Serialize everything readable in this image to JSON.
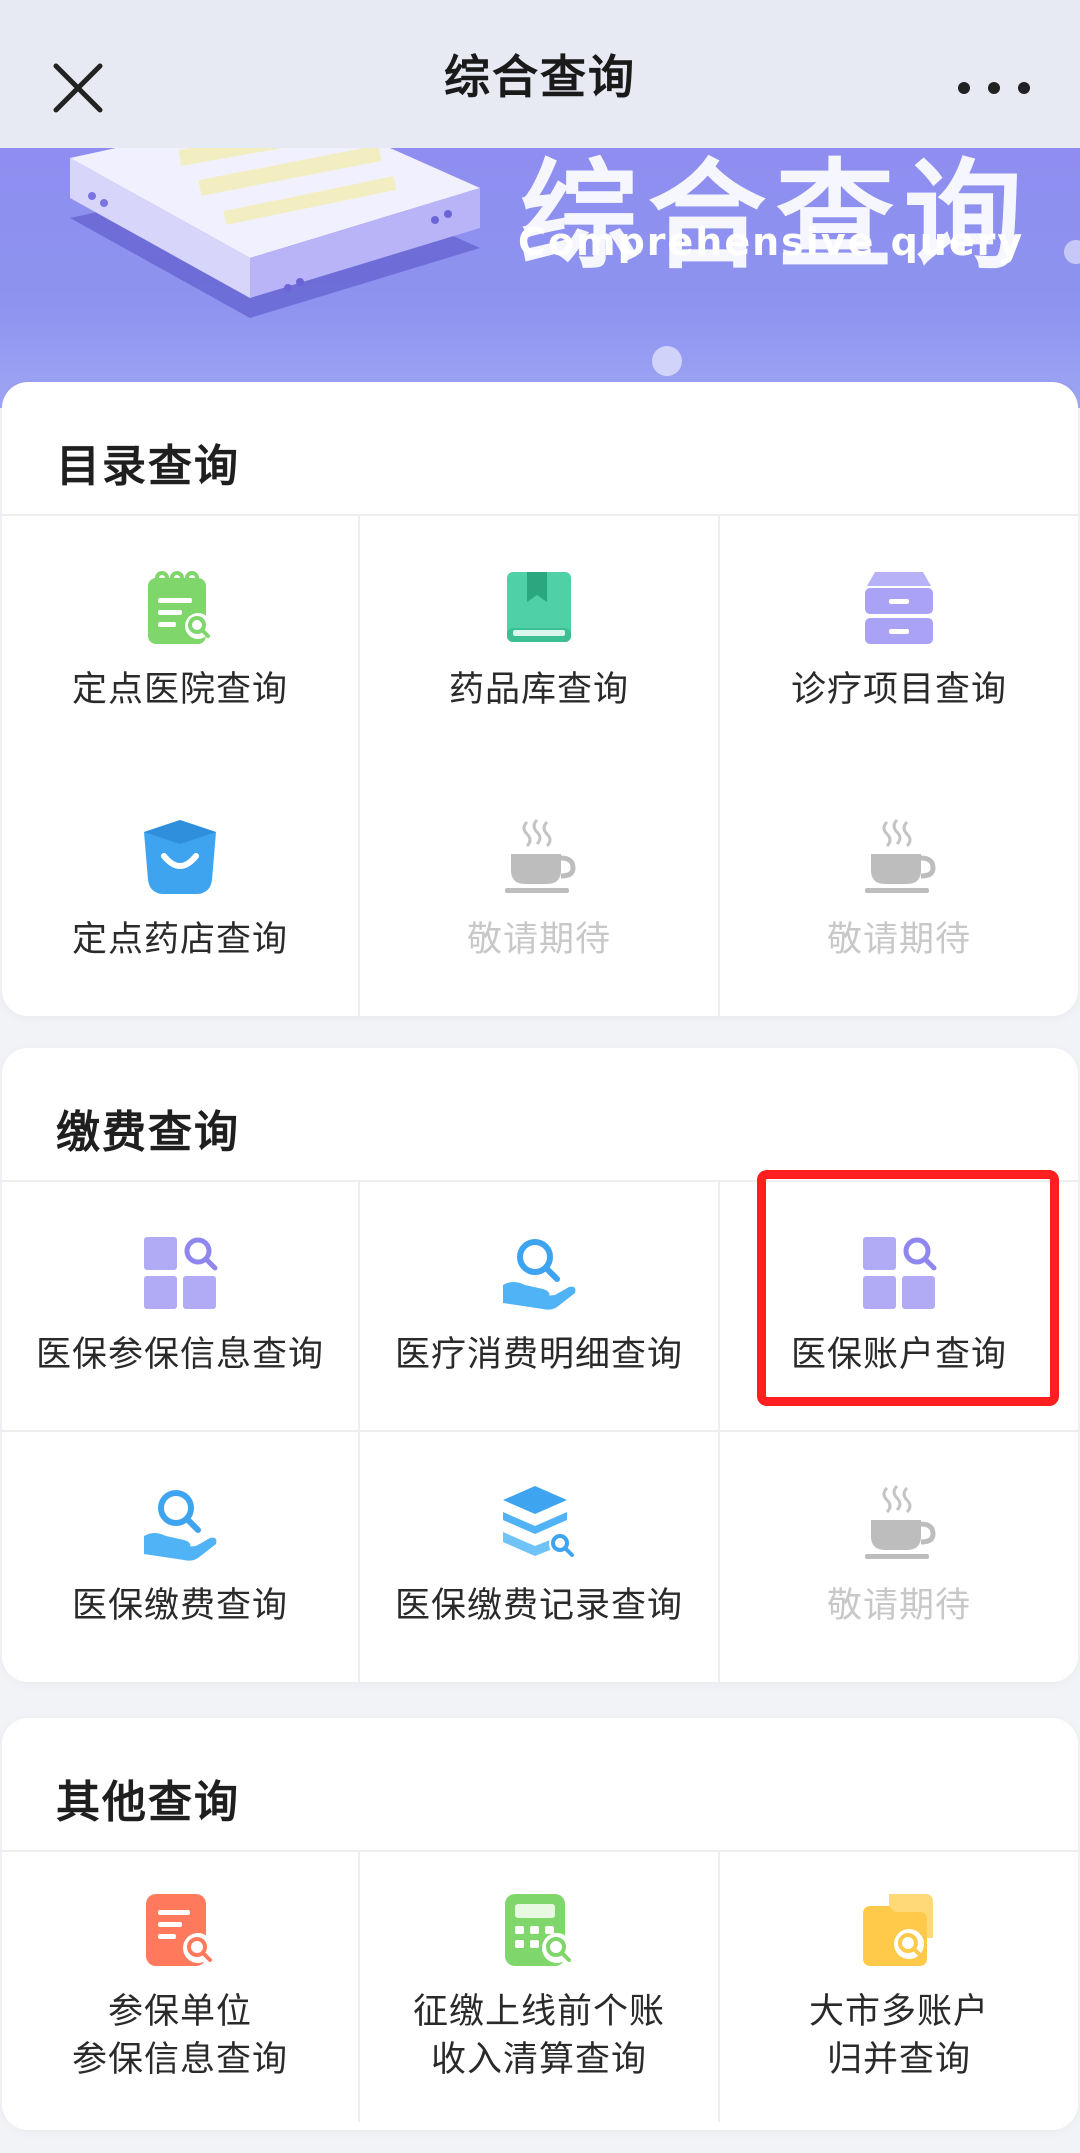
{
  "header": {
    "title": "综合查询"
  },
  "banner": {
    "title": "综合查询",
    "subtitle": "Comprehensive query"
  },
  "sections": [
    {
      "title": "目录查询",
      "items": [
        {
          "label": "定点医院查询",
          "icon": "hospital-list-icon",
          "enabled": true
        },
        {
          "label": "药品库查询",
          "icon": "book-icon",
          "enabled": true
        },
        {
          "label": "诊疗项目查询",
          "icon": "cabinet-icon",
          "enabled": true
        },
        {
          "label": "定点药店查询",
          "icon": "shopping-bag-icon",
          "enabled": true
        },
        {
          "label": "敬请期待",
          "icon": "coffee-icon",
          "enabled": false
        },
        {
          "label": "敬请期待",
          "icon": "coffee-icon",
          "enabled": false
        }
      ]
    },
    {
      "title": "缴费查询",
      "items": [
        {
          "label": "医保参保信息查询",
          "icon": "grid-search-icon",
          "enabled": true
        },
        {
          "label": "医疗消费明细查询",
          "icon": "hand-search-icon",
          "enabled": true
        },
        {
          "label": "医保账户查询",
          "icon": "grid-search-icon",
          "enabled": true,
          "highlighted": true
        },
        {
          "label": "医保缴费查询",
          "icon": "hand-search-icon",
          "enabled": true
        },
        {
          "label": "医保缴费记录查询",
          "icon": "layers-search-icon",
          "enabled": true
        },
        {
          "label": "敬请期待",
          "icon": "coffee-icon",
          "enabled": false
        }
      ]
    },
    {
      "title": "其他查询",
      "items": [
        {
          "label": "参保单位\n参保信息查询",
          "icon": "document-search-icon",
          "enabled": true
        },
        {
          "label": "征缴上线前个账\n收入清算查询",
          "icon": "calculator-search-icon",
          "enabled": true
        },
        {
          "label": "大市多账户\n归并查询",
          "icon": "folder-search-icon",
          "enabled": true
        }
      ]
    }
  ],
  "colors": {
    "accent_green": "#7fd66a",
    "accent_teal": "#4fd0a6",
    "accent_purple": "#a9a2f5",
    "accent_blue": "#3fa4f0",
    "accent_orange": "#ff7a5c",
    "accent_yellow": "#ffc94a",
    "highlight_red": "#ff1f1f"
  }
}
